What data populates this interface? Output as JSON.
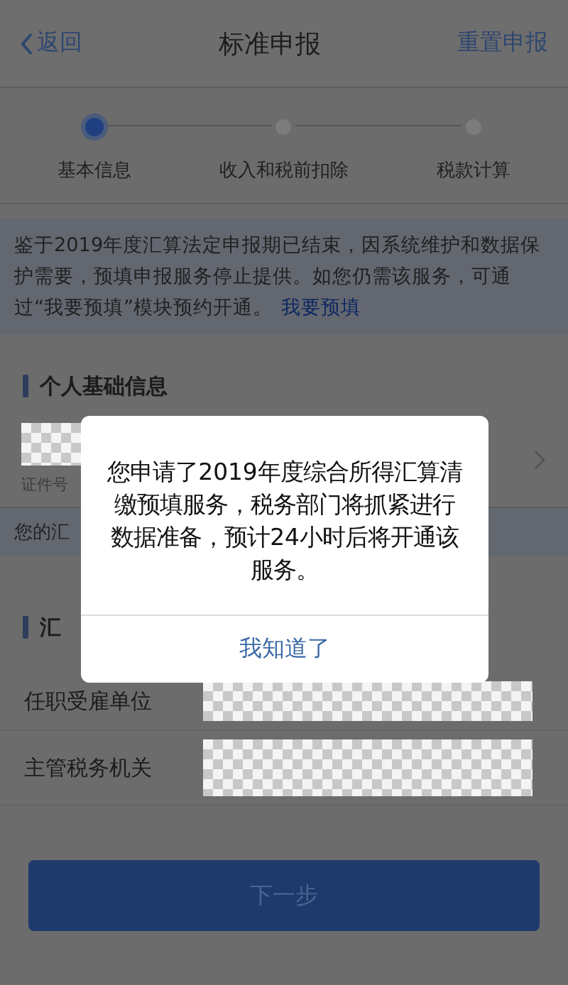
{
  "nav": {
    "back": "返回",
    "title": "标准申报",
    "action": "重置申报"
  },
  "steps": [
    {
      "label": "基本信息",
      "selected": true
    },
    {
      "label": "收入和税前扣除",
      "selected": false
    },
    {
      "label": "税款计算",
      "selected": false
    }
  ],
  "notice": {
    "text": "鉴于2019年度汇算法定申报期已结束，因系统维护和数据保护需要，预填申报服务停止提供。如您仍需该服务，可通过“我要预填”模块预约开通。",
    "link": "我要预填"
  },
  "personal": {
    "heading": "个人基础信息",
    "id_label": "证件号"
  },
  "summary_note": "您的汇",
  "section2": {
    "heading": "汇",
    "rows": [
      "任职受雇单位",
      "主管税务机关"
    ]
  },
  "next_button": "下一步",
  "dialog": {
    "message": "您申请了2019年度综合所得汇算清缴预填服务，税务部门将抓紧进行数据准备，预计24小时后将开通该服务。",
    "button": "我知道了"
  }
}
